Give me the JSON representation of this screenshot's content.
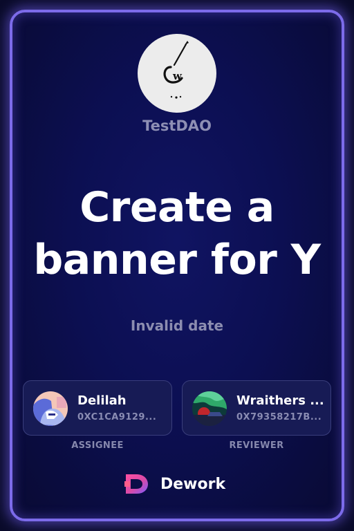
{
  "dao": {
    "name": "TestDAO",
    "logo_icon": "brush-w-logo-icon"
  },
  "task": {
    "title_line1": "Create a",
    "title_line2": "banner for Y",
    "date": "Invalid date"
  },
  "assignee": {
    "name": "Delilah",
    "address": "0XC1CA9129...",
    "role_label": "ASSIGNEE"
  },
  "reviewer": {
    "name": "Wraithers ...",
    "address": "0X79358217B...",
    "role_label": "REVIEWER"
  },
  "brand": {
    "name": "Dework",
    "icon": "dework-logo-icon"
  },
  "colors": {
    "border": "#7c6bea",
    "background": "#0c0f52",
    "text_primary": "#ffffff",
    "text_muted": "#8e8fb4"
  }
}
